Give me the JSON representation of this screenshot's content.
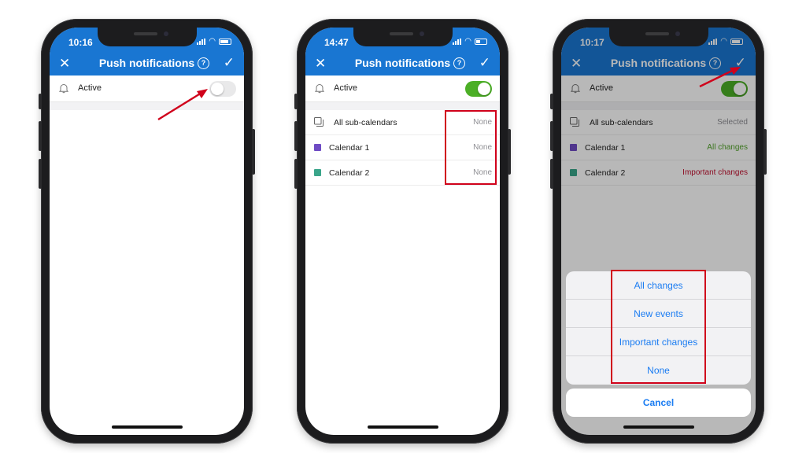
{
  "screen_title": "Push notifications",
  "active_label": "Active",
  "colors": {
    "header_blue": "#1976d2",
    "toggle_on": "#4caf26",
    "calendar1": "#6f4cc4",
    "calendar2": "#3aa58a",
    "all_changes": "#52a32a",
    "important_changes": "#c0102f",
    "action_blue": "#1a7cf2",
    "highlight_red": "#d0021b"
  },
  "phones": [
    {
      "time": "10:16",
      "toggle": "off",
      "rows": []
    },
    {
      "time": "14:47",
      "toggle": "on",
      "rows": [
        {
          "label": "All sub-calendars",
          "value": "None",
          "icon": "pages-icon"
        },
        {
          "label": "Calendar 1",
          "value": "None",
          "swatch": "calendar1"
        },
        {
          "label": "Calendar 2",
          "value": "None",
          "swatch": "calendar2"
        }
      ]
    },
    {
      "time": "10:17",
      "toggle": "on",
      "rows": [
        {
          "label": "All sub-calendars",
          "value": "Selected",
          "icon": "pages-icon"
        },
        {
          "label": "Calendar 1",
          "value": "All changes",
          "swatch": "calendar1"
        },
        {
          "label": "Calendar 2",
          "value": "Important changes",
          "swatch": "calendar2"
        }
      ],
      "action_sheet": {
        "options": [
          "All changes",
          "New events",
          "Important changes",
          "None"
        ],
        "cancel": "Cancel"
      }
    }
  ]
}
